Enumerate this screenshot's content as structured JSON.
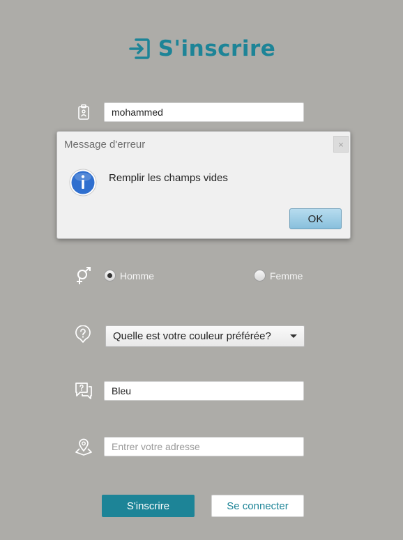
{
  "header": {
    "title": "S'inscrire",
    "icon": "sign-in-icon"
  },
  "form": {
    "name": {
      "value": "mohammed",
      "icon": "id-badge-icon"
    },
    "gender": {
      "icon": "gender-icon",
      "options": [
        {
          "label": "Homme",
          "selected": true
        },
        {
          "label": "Femme",
          "selected": false
        }
      ]
    },
    "security_question": {
      "selected": "Quelle est votre couleur préférée?",
      "icon": "question-pin-icon"
    },
    "answer": {
      "value": "Bleu",
      "icon": "chat-question-icon"
    },
    "address": {
      "value": "",
      "placeholder": "Entrer votre adresse",
      "icon": "location-icon"
    }
  },
  "buttons": {
    "register": "S'inscrire",
    "login": "Se connecter"
  },
  "dialog": {
    "title": "Message d'erreur",
    "close": "×",
    "message": "Remplir les champs vides",
    "ok": "OK",
    "icon": "info-icon"
  },
  "colors": {
    "accent": "#1d8497",
    "background": "#adaca8",
    "info_blue": "#2f6fcf"
  }
}
